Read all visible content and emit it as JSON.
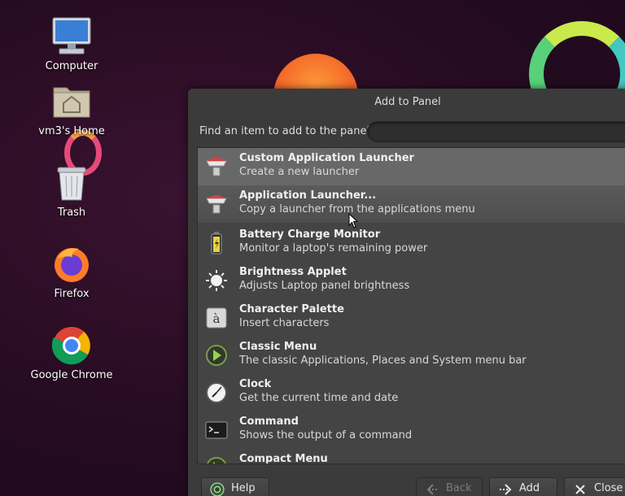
{
  "desktop": {
    "icons": [
      {
        "label": "Computer",
        "icon": "computer-icon"
      },
      {
        "label": "vm3's Home",
        "icon": "home-folder-icon"
      },
      {
        "label": "Trash",
        "icon": "trash-icon"
      },
      {
        "label": "Firefox",
        "icon": "firefox-icon"
      },
      {
        "label": "Google Chrome",
        "icon": "chrome-icon"
      }
    ]
  },
  "dialog": {
    "title": "Add to Panel",
    "find_label": "Find an item to add to the panel:",
    "search_value": "",
    "items": [
      {
        "name": "Custom Application Launcher",
        "desc": "Create a new launcher",
        "icon": "launcher-icon",
        "state": "selected"
      },
      {
        "name": "Application Launcher...",
        "desc": "Copy a launcher from the applications menu",
        "icon": "launcher-icon",
        "state": "hover"
      },
      {
        "name": "Battery Charge Monitor",
        "desc": "Monitor a laptop's remaining power",
        "icon": "battery-icon",
        "state": ""
      },
      {
        "name": "Brightness Applet",
        "desc": "Adjusts Laptop panel brightness",
        "icon": "brightness-icon",
        "state": ""
      },
      {
        "name": "Character Palette",
        "desc": "Insert characters",
        "icon": "character-palette-icon",
        "state": ""
      },
      {
        "name": "Classic Menu",
        "desc": "The classic Applications, Places and System menu bar",
        "icon": "classic-menu-icon",
        "state": ""
      },
      {
        "name": "Clock",
        "desc": "Get the current time and date",
        "icon": "clock-icon",
        "state": ""
      },
      {
        "name": "Command",
        "desc": "Shows the output of a command",
        "icon": "terminal-icon",
        "state": ""
      },
      {
        "name": "Compact Menu",
        "desc": "",
        "icon": "compact-menu-icon",
        "state": ""
      }
    ],
    "buttons": {
      "help": "Help",
      "back": "Back",
      "add": "Add",
      "close": "Close"
    }
  },
  "colors": {
    "dialog_bg": "#3b3b3b",
    "list_bg": "#444444",
    "selected_row": "#686868"
  }
}
